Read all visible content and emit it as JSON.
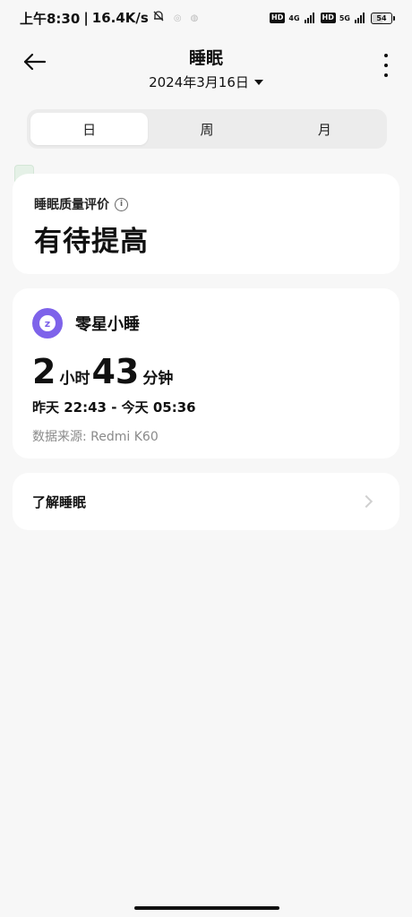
{
  "status_bar": {
    "time": "上午8:30",
    "speed": "16.4K/s",
    "hd1": "HD",
    "net1": "4G",
    "hd2": "HD",
    "net2": "5G",
    "battery": "54"
  },
  "header": {
    "title": "睡眠",
    "date": "2024年3月16日"
  },
  "tabs": [
    {
      "label": "日",
      "active": true
    },
    {
      "label": "周",
      "active": false
    },
    {
      "label": "月",
      "active": false
    }
  ],
  "quality": {
    "label": "睡眠质量评价",
    "value": "有待提高"
  },
  "nap": {
    "title": "零星小睡",
    "hours": "2",
    "hours_unit": "小时",
    "minutes": "43",
    "minutes_unit": "分钟",
    "time_range": "昨天 22:43 - 今天 05:36",
    "source": "数据来源: Redmi K60"
  },
  "learn": {
    "label": "了解睡眠"
  },
  "colors": {
    "accent": "#7e63ea",
    "background": "#f7f7f7"
  }
}
